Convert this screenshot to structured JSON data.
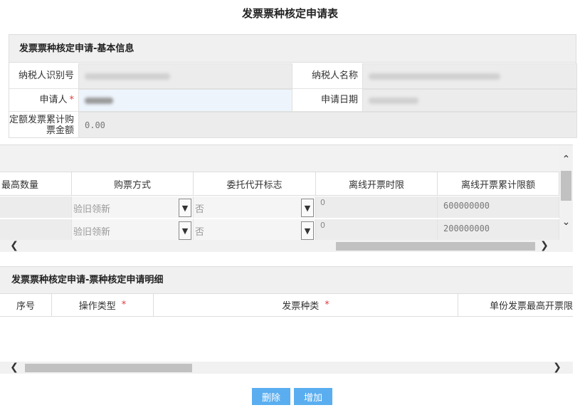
{
  "page_title": "发票票种核定申请表",
  "basic_info": {
    "header": "发票票种核定申请-基本信息",
    "taxpayer_id_label": "纳税人识别号",
    "taxpayer_name_label": "纳税人名称",
    "applicant_label": "申请人",
    "apply_date_label": "申请日期",
    "fixed_invoice_amount_label": "定额发票累计购票金额",
    "fixed_invoice_amount_value": "0.00",
    "required_mark": "*"
  },
  "grid1": {
    "columns": [
      "最高数量",
      "购票方式",
      "委托代开标志",
      "离线开票时限",
      "离线开票累计限额"
    ],
    "rows": [
      {
        "purchase_method": "验旧领新",
        "proxy_flag": "否",
        "offline_time": "0",
        "offline_limit": "600000000"
      },
      {
        "purchase_method": "验旧领新",
        "proxy_flag": "否",
        "offline_time": "0",
        "offline_limit": "200000000"
      }
    ]
  },
  "detail": {
    "header": "发票票种核定申请-票种核定申请明细",
    "columns": [
      "序号",
      "操作类型",
      "发票种类",
      "单份发票最高开票限"
    ],
    "required_mark": "*"
  },
  "buttons": {
    "delete": "删除",
    "add": "增加"
  },
  "icons": {
    "scroll_up": "chevron-up-icon",
    "scroll_down": "chevron-down-icon",
    "scroll_left": "chevron-left-icon",
    "scroll_right": "chevron-right-icon",
    "dropdown": "chevron-down-icon"
  },
  "colors": {
    "button": "#5aaef0",
    "required": "#e4393c",
    "header_bg": "#f0f0f0"
  }
}
